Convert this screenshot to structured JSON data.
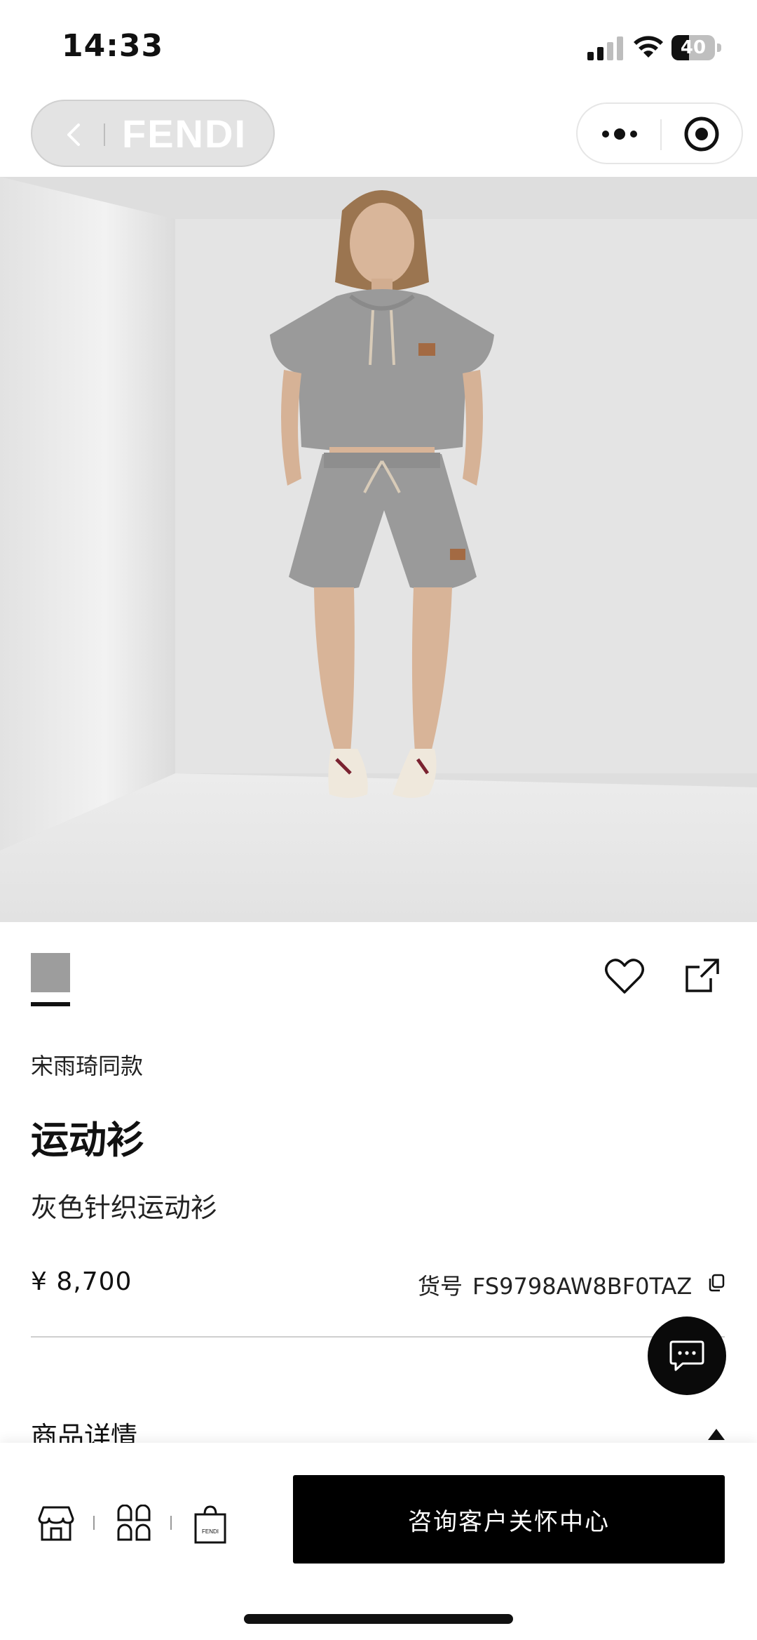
{
  "status_bar": {
    "time": "14:33",
    "battery": "40",
    "battery_fill_fraction": 0.4
  },
  "nav": {
    "brand": "FENDI",
    "icons": [
      "back-chevron-icon",
      "more-dots-icon",
      "target-icon"
    ]
  },
  "product": {
    "image_alt_icon": "product-photo",
    "color_swatch": "#9d9d9d",
    "tag": "宋雨琦同款",
    "title": "运动衫",
    "subtitle": "灰色针织运动衫",
    "price": "¥ 8,700",
    "sku_label": "货号",
    "sku_value": "FS9798AW8BF0TAZ"
  },
  "details": {
    "label": "商品详情"
  },
  "bottom_bar": {
    "icons": [
      "store-icon",
      "categories-icon",
      "shopping-bag-icon"
    ],
    "bag_text": "FENDI",
    "cta_label": "咨询客户关怀中心"
  },
  "colors": {
    "accent": "#000000",
    "background": "#ffffff"
  }
}
